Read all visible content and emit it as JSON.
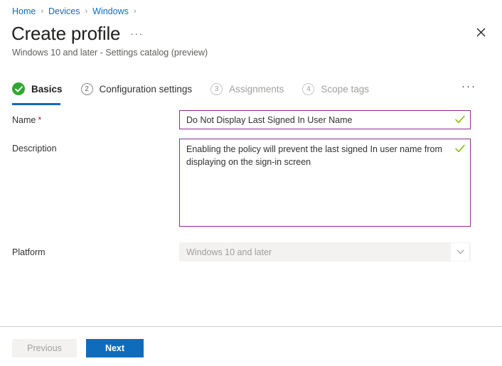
{
  "breadcrumb": {
    "items": [
      {
        "label": "Home"
      },
      {
        "label": "Devices"
      },
      {
        "label": "Windows"
      }
    ],
    "separator": "›",
    "trailing_separator": "›",
    "link_color": "#0f6cbd"
  },
  "header": {
    "title": "Create profile",
    "ellipsis": "···",
    "subtitle": "Windows 10 and later - Settings catalog (preview)",
    "close_icon": "close-icon"
  },
  "wizard": {
    "steps": [
      {
        "number": "",
        "label": "Basics",
        "state": "completed-active",
        "icon": "check-circle-icon"
      },
      {
        "number": "2",
        "label": "Configuration settings",
        "state": "enabled"
      },
      {
        "number": "3",
        "label": "Assignments",
        "state": "disabled"
      },
      {
        "number": "4",
        "label": "Scope tags",
        "state": "disabled"
      }
    ],
    "overflow": "···",
    "active_underline_color": "#0f6cbd",
    "completed_color": "#2fa82f"
  },
  "form": {
    "name": {
      "label": "Name",
      "required_mark": "*",
      "value": "Do Not Display Last Signed In User Name",
      "placeholder": "",
      "valid": true,
      "border_color": "#8b2d8b",
      "check_icon": "checkmark-icon"
    },
    "description": {
      "label": "Description",
      "value": "Enabling the policy will prevent the last signed In user name from displaying on the sign-in screen",
      "placeholder": "",
      "valid": true,
      "border_color": "#8b2d8b",
      "check_icon": "checkmark-icon"
    },
    "platform": {
      "label": "Platform",
      "value": "Windows 10 and later",
      "disabled": true,
      "chevron_icon": "chevron-down-icon"
    }
  },
  "footer": {
    "previous_label": "Previous",
    "previous_disabled": true,
    "next_label": "Next",
    "next_color": "#0f6cbd"
  }
}
